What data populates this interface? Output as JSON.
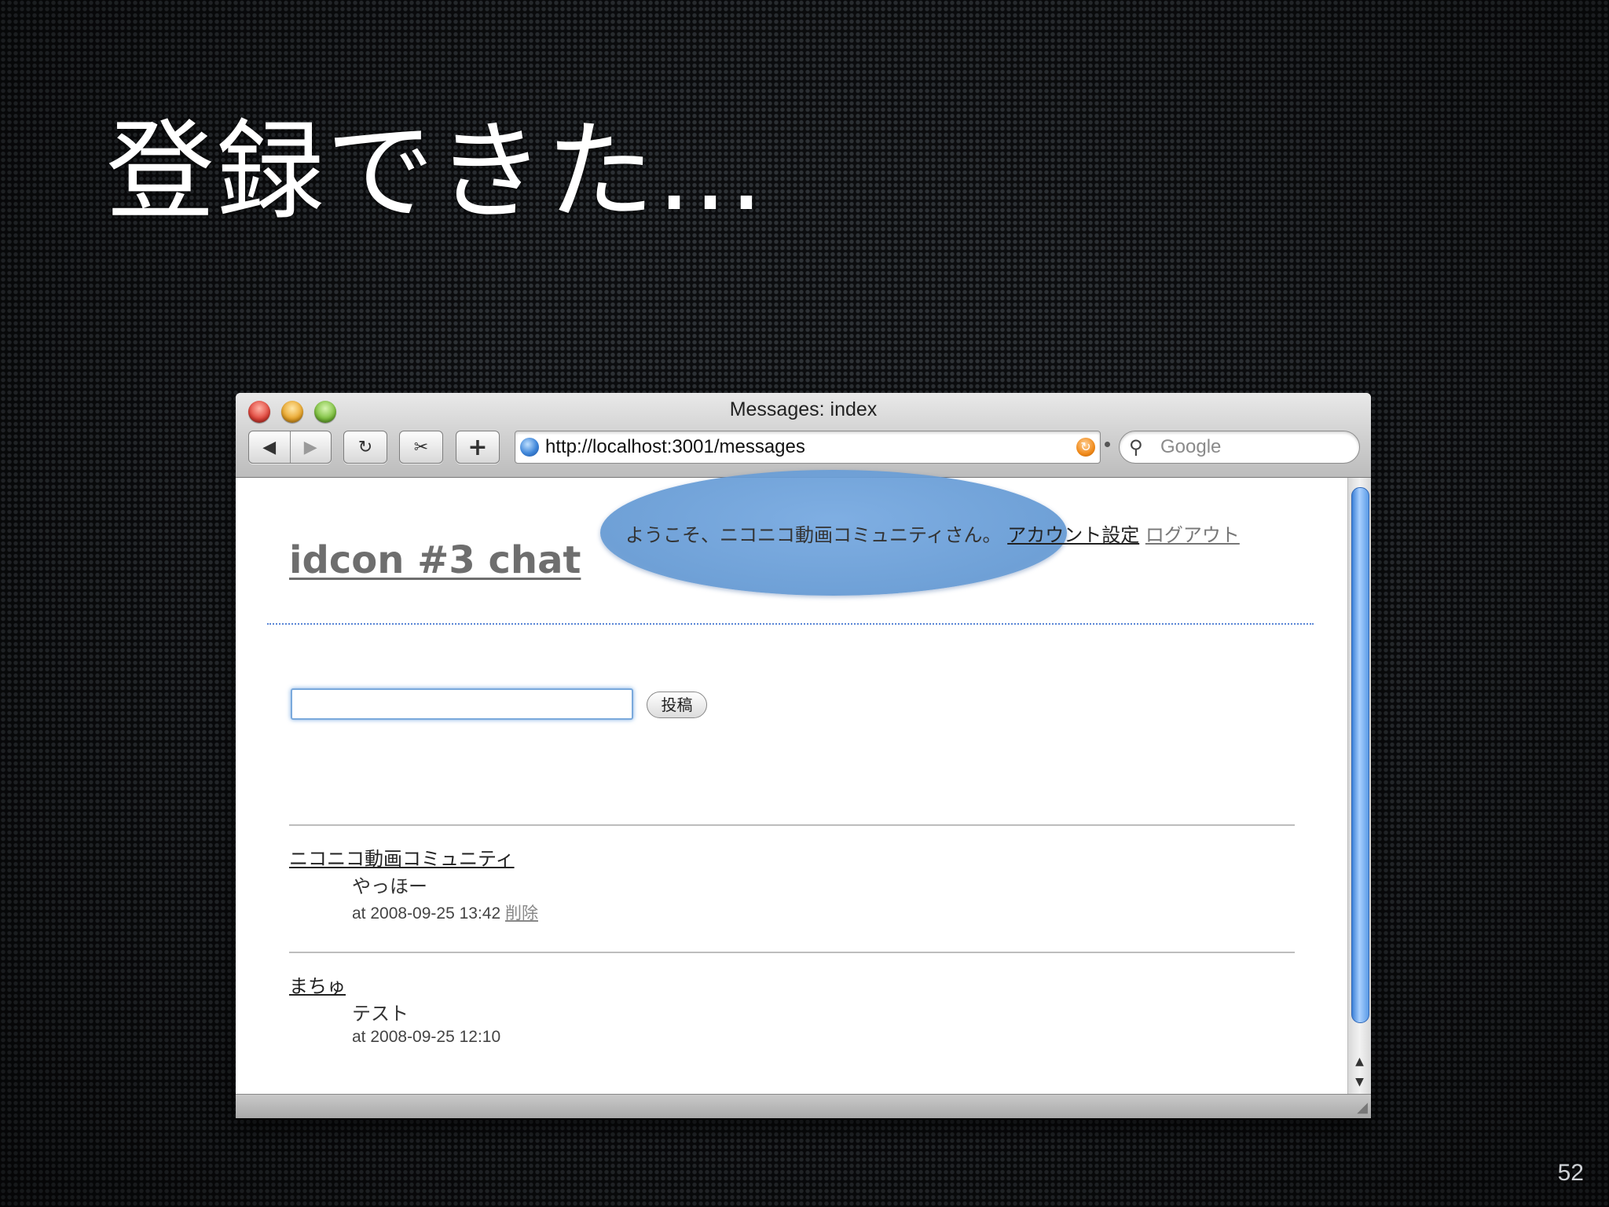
{
  "slide": {
    "title": "登録できた…",
    "page_number": "52"
  },
  "window": {
    "title": "Messages: index",
    "url": "http://localhost:3001/messages",
    "search_placeholder": "Google",
    "toolbar": {
      "back_icon": "◀",
      "forward_icon": "▶",
      "reload_icon": "↻",
      "snip_icon": "✂",
      "add_tab_icon": "+"
    }
  },
  "page": {
    "site_title": "idcon #3 chat",
    "welcome": "ようこそ、ニコニコ動画コミュニティさん。",
    "account_settings": "アカウント設定",
    "logout": "ログアウト",
    "post_button": "投稿",
    "messages": [
      {
        "author": "ニコニコ動画コミュニティ",
        "body": "やっほー",
        "meta": "at 2008-09-25 13:42",
        "delete": "削除"
      },
      {
        "author": "まちゅ",
        "body": "テスト",
        "meta": "at 2008-09-25 12:10"
      }
    ]
  }
}
